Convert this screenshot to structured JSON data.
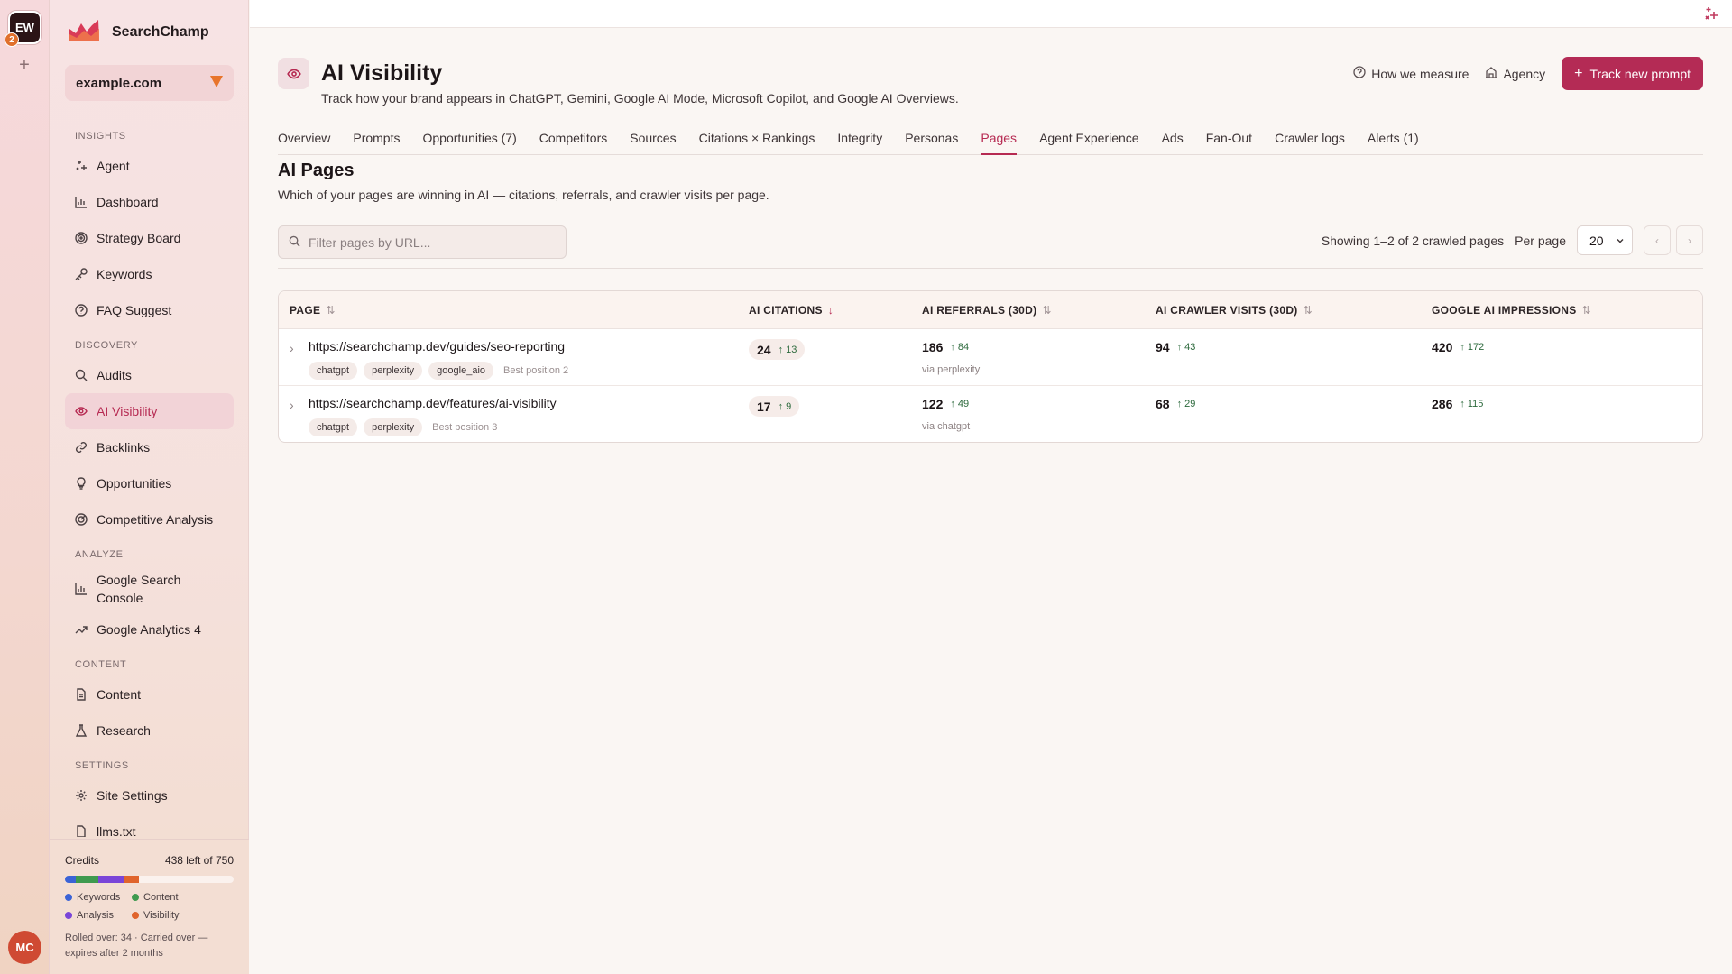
{
  "rail": {
    "workspace_initials": "EW",
    "workspace_badge": "2",
    "add_label": "+",
    "user_initials": "MC"
  },
  "brand": {
    "name": "SearchChamp",
    "logo_icon": "chart-crown-logo"
  },
  "site_selector": {
    "value": "example.com"
  },
  "nav": {
    "sections": [
      {
        "title": "INSIGHTS",
        "items": [
          {
            "label": "Agent",
            "icon": "sparkle-icon"
          },
          {
            "label": "Dashboard",
            "icon": "bar-chart-icon"
          },
          {
            "label": "Strategy Board",
            "icon": "target-icon"
          },
          {
            "label": "Keywords",
            "icon": "key-icon"
          },
          {
            "label": "FAQ Suggest",
            "icon": "help-circle-icon"
          }
        ]
      },
      {
        "title": "DISCOVERY",
        "items": [
          {
            "label": "Audits",
            "icon": "search-icon"
          },
          {
            "label": "AI Visibility",
            "icon": "eye-icon",
            "active": true
          },
          {
            "label": "Backlinks",
            "icon": "link-icon"
          },
          {
            "label": "Opportunities",
            "icon": "lightbulb-icon"
          },
          {
            "label": "Competitive Analysis",
            "icon": "radar-icon"
          }
        ]
      },
      {
        "title": "ANALYZE",
        "items": [
          {
            "label": "Google Search Console",
            "icon": "bar-chart-icon"
          },
          {
            "label": "Google Analytics 4",
            "icon": "trend-icon"
          }
        ]
      },
      {
        "title": "CONTENT",
        "items": [
          {
            "label": "Content",
            "icon": "document-icon"
          },
          {
            "label": "Research",
            "icon": "flask-icon"
          }
        ]
      },
      {
        "title": "SETTINGS",
        "items": [
          {
            "label": "Site Settings",
            "icon": "gear-icon"
          },
          {
            "label": "llms.txt",
            "icon": "file-icon"
          }
        ]
      }
    ]
  },
  "credits": {
    "label": "Credits",
    "remaining": "438 left of 750",
    "usage": [
      {
        "name": "Keywords",
        "fraction": 0.025,
        "color": "#3b63d6"
      },
      {
        "name": "Content",
        "fraction": 0.055,
        "color": "#3f9a4f"
      },
      {
        "name": "Analysis",
        "fraction": 0.06,
        "color": "#7a45d8"
      },
      {
        "name": "Visibility",
        "fraction": 0.035,
        "color": "#e0642c"
      }
    ],
    "note": "Rolled over: 34 · Carried over — expires after 2 months"
  },
  "header": {
    "title": "AI Visibility",
    "subtitle": "Track how your brand appears in ChatGPT, Gemini, Google AI Mode, Microsoft Copilot, and Google AI Overviews.",
    "how_label": "How we measure",
    "agency_label": "Agency",
    "track_label": "Track new prompt",
    "accent": "#b42b55"
  },
  "tabs": [
    {
      "label": "Overview"
    },
    {
      "label": "Prompts"
    },
    {
      "label": "Opportunities (7)"
    },
    {
      "label": "Competitors"
    },
    {
      "label": "Sources"
    },
    {
      "label": "Citations × Rankings"
    },
    {
      "label": "Integrity"
    },
    {
      "label": "Personas"
    },
    {
      "label": "Pages",
      "active": true
    },
    {
      "label": "Agent Experience"
    },
    {
      "label": "Ads"
    },
    {
      "label": "Fan-Out"
    },
    {
      "label": "Crawler logs"
    },
    {
      "label": "Alerts (1)"
    }
  ],
  "section": {
    "title": "AI Pages",
    "description": "Which of your pages are winning in AI — citations, referrals, and crawler visits per page."
  },
  "filter": {
    "placeholder": "Filter pages by URL..."
  },
  "pagination": {
    "summary": "Showing 1–2 of 2 crawled pages",
    "per_page_label": "Per page",
    "per_page_value": "20",
    "prev": "‹",
    "next": "›"
  },
  "table": {
    "columns": [
      {
        "label": "PAGE",
        "sort": "⇅"
      },
      {
        "label": "AI CITATIONS",
        "sort": "↓",
        "sorted": true
      },
      {
        "label": "AI REFERRALS (30D)",
        "sort": "⇅"
      },
      {
        "label": "AI CRAWLER VISITS (30D)",
        "sort": "⇅"
      },
      {
        "label": "GOOGLE AI IMPRESSIONS",
        "sort": "⇅"
      }
    ],
    "rows": [
      {
        "url": "https://searchchamp.dev/guides/seo-reporting",
        "tags": [
          "chatgpt",
          "perplexity",
          "google_aio"
        ],
        "best": "Best position 2",
        "citations": "24",
        "citations_delta": "13",
        "referrals": "186",
        "referrals_delta": "84",
        "referrals_via": "via perplexity",
        "crawler": "94",
        "crawler_delta": "43",
        "impressions": "420",
        "impressions_delta": "172"
      },
      {
        "url": "https://searchchamp.dev/features/ai-visibility",
        "tags": [
          "chatgpt",
          "perplexity"
        ],
        "best": "Best position 3",
        "citations": "17",
        "citations_delta": "9",
        "referrals": "122",
        "referrals_delta": "49",
        "referrals_via": "via chatgpt",
        "crawler": "68",
        "crawler_delta": "29",
        "impressions": "286",
        "impressions_delta": "115"
      }
    ]
  }
}
